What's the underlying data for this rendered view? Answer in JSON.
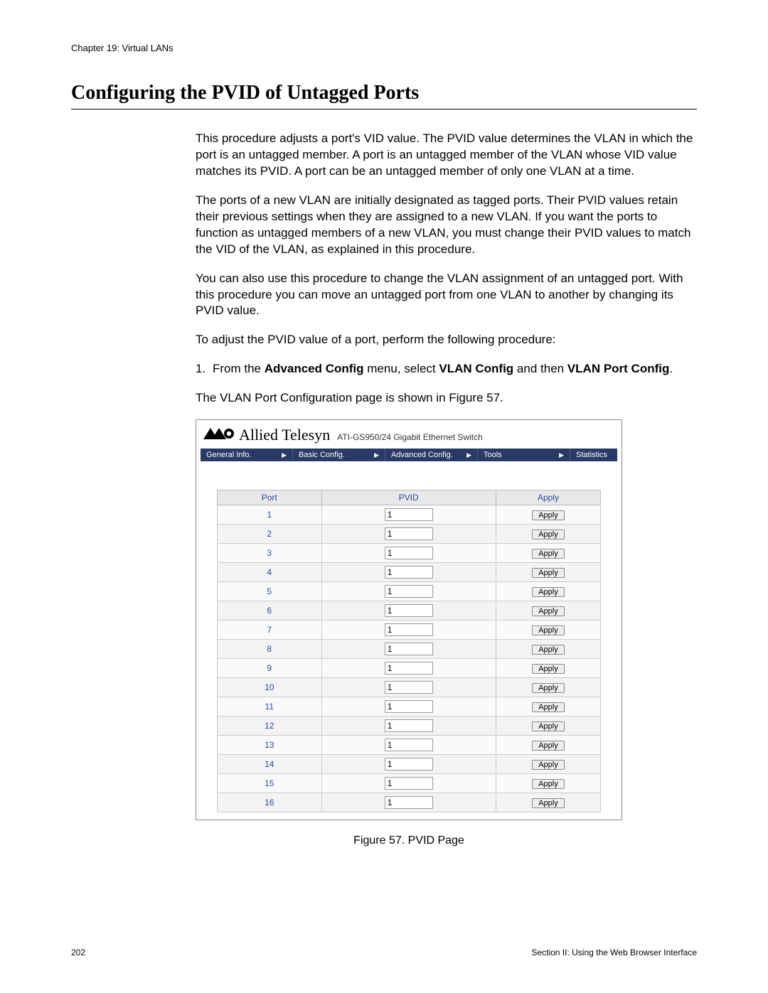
{
  "header": {
    "chapter": "Chapter 19: Virtual LANs"
  },
  "title": "Configuring the PVID of Untagged Ports",
  "paragraphs": {
    "p1": "This procedure adjusts a port's VID value. The PVID value determines the VLAN in which the port is an untagged member. A port is an untagged member of the VLAN whose VID value matches its PVID. A port can be an untagged member of only one VLAN at a time.",
    "p2": "The ports of a new VLAN are initially designated as tagged ports. Their PVID values retain their previous settings when they are assigned to a new VLAN. If you want the ports to function as untagged members of a new VLAN, you must change their PVID values to match the VID of the VLAN, as explained in this procedure.",
    "p3": "You can also use this procedure to change the VLAN assignment of an untagged port. With this procedure you can move an untagged port from one VLAN to another by changing its PVID value.",
    "p4": "To adjust the PVID value of a port, perform the following procedure:",
    "step1_num": "1.",
    "step1_a": "From the ",
    "step1_b": "Advanced Config",
    "step1_c": " menu, select ",
    "step1_d": "VLAN Config",
    "step1_e": " and then ",
    "step1_f": "VLAN Port Config",
    "step1_g": ".",
    "p5": "The VLAN Port Configuration page is shown in Figure 57."
  },
  "switch": {
    "brand": "Allied Telesyn",
    "model": "ATI-GS950/24 Gigabit Ethernet Switch",
    "menu": [
      {
        "label": "General Info.",
        "arrow": true
      },
      {
        "label": "Basic Config.",
        "arrow": true
      },
      {
        "label": "Advanced Config.",
        "arrow": true
      },
      {
        "label": "Tools",
        "arrow": true
      },
      {
        "label": "Statistics",
        "arrow": false
      }
    ],
    "columns": {
      "port": "Port",
      "pvid": "PVID",
      "apply": "Apply"
    },
    "apply_label": "Apply",
    "rows": [
      {
        "port": "1",
        "pvid": "1"
      },
      {
        "port": "2",
        "pvid": "1"
      },
      {
        "port": "3",
        "pvid": "1"
      },
      {
        "port": "4",
        "pvid": "1"
      },
      {
        "port": "5",
        "pvid": "1"
      },
      {
        "port": "6",
        "pvid": "1"
      },
      {
        "port": "7",
        "pvid": "1"
      },
      {
        "port": "8",
        "pvid": "1"
      },
      {
        "port": "9",
        "pvid": "1"
      },
      {
        "port": "10",
        "pvid": "1"
      },
      {
        "port": "11",
        "pvid": "1"
      },
      {
        "port": "12",
        "pvid": "1"
      },
      {
        "port": "13",
        "pvid": "1"
      },
      {
        "port": "14",
        "pvid": "1"
      },
      {
        "port": "15",
        "pvid": "1"
      },
      {
        "port": "16",
        "pvid": "1"
      }
    ]
  },
  "figure_caption": "Figure 57. PVID Page",
  "footer": {
    "page_number": "202",
    "section": "Section II: Using the Web Browser Interface"
  }
}
